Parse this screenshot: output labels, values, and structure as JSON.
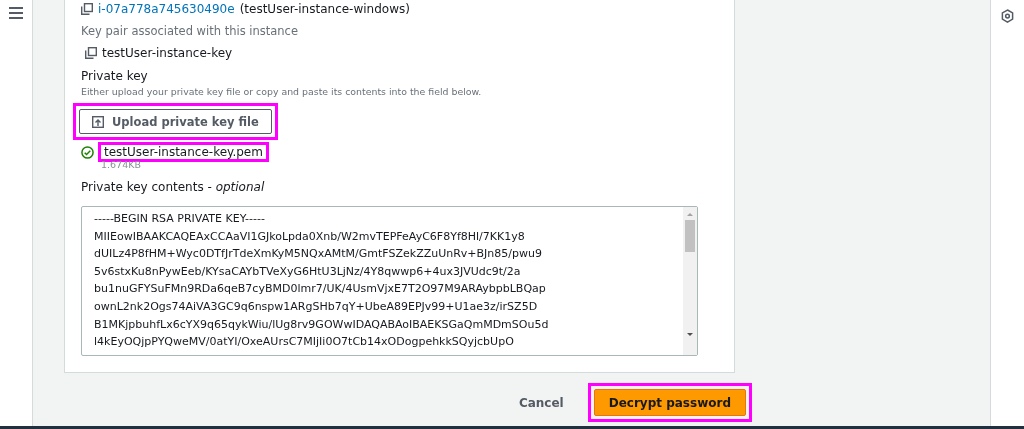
{
  "instance": {
    "id": "i-07a778a745630490e",
    "name": "(testUser-instance-windows)"
  },
  "key_pair": {
    "label": "Key pair associated with this instance",
    "value": "testUser-instance-key"
  },
  "private_key": {
    "label": "Private key",
    "description": "Either upload your private key file or copy and paste its contents into the field below.",
    "upload_button": {
      "label": "Upload private key file",
      "highlighted": true
    },
    "file": {
      "name": "testUser-instance-key.pem",
      "size": "1.674KB",
      "uploaded": true,
      "highlighted": true
    }
  },
  "contents": {
    "label": "Private key contents - ",
    "label_suffix": "optional",
    "lines": [
      "-----BEGIN RSA PRIVATE KEY-----",
      "MIIEowIBAAKCAQEAxCCAaVI1GJkoLpda0Xnb/W2mvTEPFeAyC6F8Yf8Hl/7KK1y8",
      "dUILz4P8fHM+Wyc0DTfJrTdeXmKyM5NQxAMtM/GmtFSZekZZuUnRv+BJn85/pwu9",
      "5v6stxKu8nPywEeb/KYsaCAYbTVeXyG6HtU3LjNz/4Y8qwwp6+4ux3JVUdc9t/2a",
      "bu1nuGFYSuFMn9RDa6qeB7cyBMD0lmr7/UK/4UsmVjxE7T2O97M9ARAybpbLBQap",
      "ownL2nk2Ogs74AiVA3GC9q6nspw1ARgSHb7qY+UbeA89EPJv99+U1ae3z/irSZ5D",
      "B1MKjpbuhfLx6cYX9q65qykWiu/lUg8rv9GOWwIDAQABAoIBAEKSGaQmMDmSOu5d",
      "l4kEyOQjpPYQweMV/0atYI/OxeAUrsC7MIjIi0O7tCb14xODogpehkkSQyjcbUpO"
    ]
  },
  "actions": [
    {
      "label": "Cancel",
      "kind": "link",
      "highlighted": false
    },
    {
      "label": "Decrypt password",
      "kind": "primary",
      "highlighted": true
    }
  ]
}
